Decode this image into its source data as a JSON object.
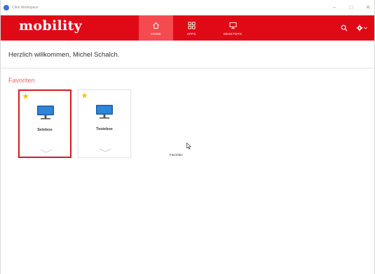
{
  "window": {
    "title": "Citrix Workspace"
  },
  "header": {
    "brand": "mobility",
    "nav": [
      {
        "label": "HOME",
        "icon": "home-icon",
        "active": true
      },
      {
        "label": "APPS",
        "icon": "apps-grid-icon",
        "active": false
      },
      {
        "label": "DESKTOPS",
        "icon": "monitor-icon",
        "active": false
      }
    ],
    "accent_color": "#e00a16"
  },
  "welcome": {
    "text": "Herzlich willkommen, Michel Schalch."
  },
  "favorites": {
    "heading": "Favoriten",
    "tiles": [
      {
        "name": "Setebos",
        "favorite": true,
        "selected": true,
        "icon": "desktop-monitor-icon"
      },
      {
        "name": "Testebos",
        "favorite": true,
        "selected": false,
        "icon": "desktop-monitor-icon"
      }
    ]
  },
  "tooltip": {
    "text": "Favoriten"
  }
}
